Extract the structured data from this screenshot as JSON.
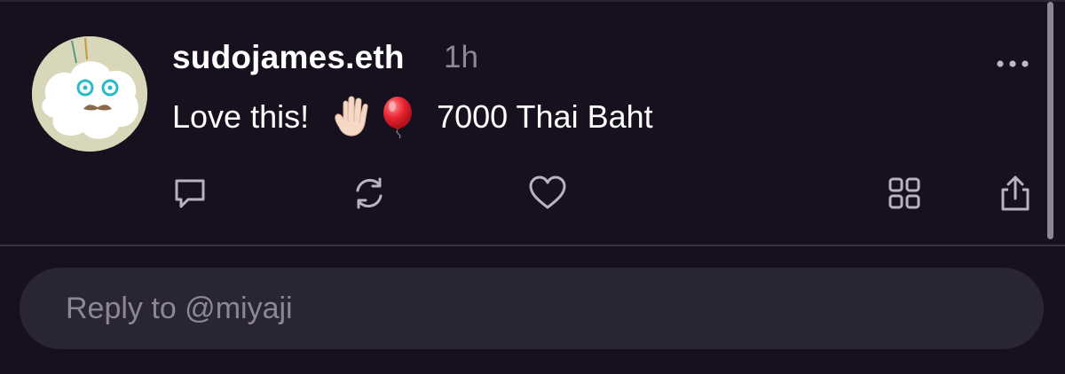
{
  "post": {
    "username": "sudojames.eth",
    "timestamp": "1h",
    "text_before": "Love this!",
    "emoji": [
      "raised-hand-light-skin",
      "red-balloon"
    ],
    "text_after": "7000 Thai Baht",
    "more_icon": "more-horizontal-icon",
    "actions": [
      {
        "name": "reply",
        "icon": "comment-icon"
      },
      {
        "name": "recast",
        "icon": "repost-icon"
      },
      {
        "name": "like",
        "icon": "heart-icon"
      },
      {
        "name": "apps",
        "icon": "grid-icon"
      },
      {
        "name": "share",
        "icon": "share-icon"
      }
    ]
  },
  "reply": {
    "placeholder": "Reply to @miyaji"
  },
  "colors": {
    "background": "#17111f",
    "text_primary": "#ffffff",
    "text_secondary": "#8d8796",
    "input_background": "#2a2533",
    "divider": "#3a3442"
  }
}
